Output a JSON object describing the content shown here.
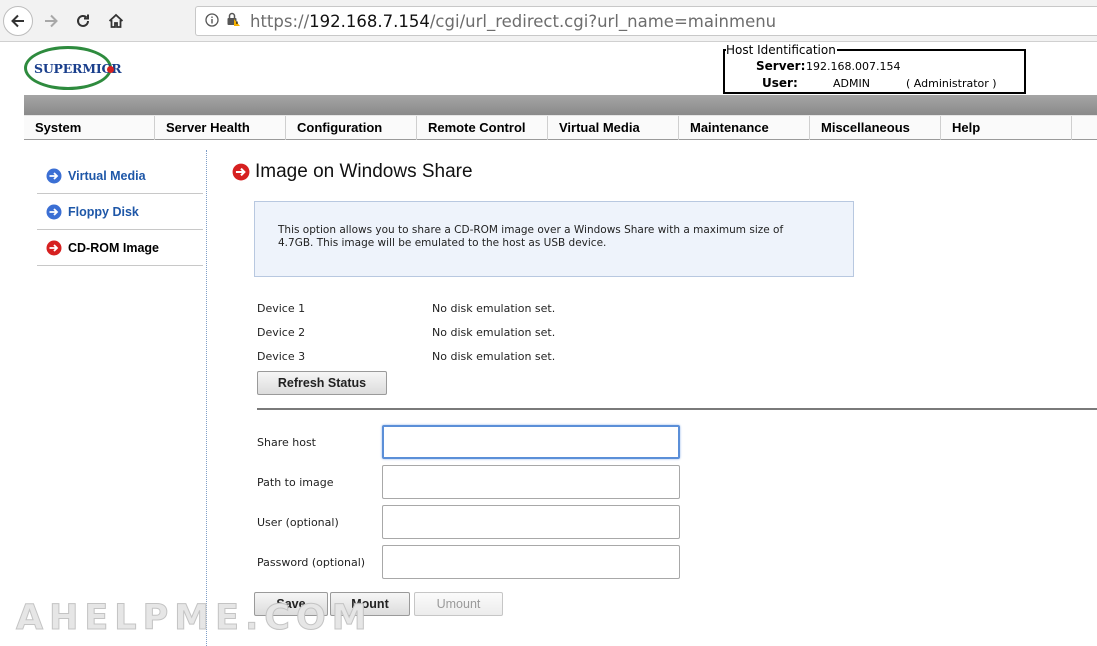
{
  "browser": {
    "url_prefix": "https://",
    "url_host": "192.168.7.154",
    "url_path": "/cgi/url_redirect.cgi?url_name=mainmenu",
    "icons": [
      "back-arrow-icon",
      "forward-arrow-icon",
      "reload-icon",
      "home-icon",
      "info-icon",
      "insecure-lock-icon"
    ]
  },
  "header": {
    "logo_text": "SUPERMICR",
    "host_identification": {
      "legend": "Host Identification",
      "server_label": "Server:",
      "server_value": "192.168.007.154",
      "user_label": "User:",
      "user_value": "ADMIN",
      "user_role": "( Administrator )"
    }
  },
  "menu": {
    "items": [
      "System",
      "Server Health",
      "Configuration",
      "Remote Control",
      "Virtual Media",
      "Maintenance",
      "Miscellaneous",
      "Help"
    ]
  },
  "sidebar": {
    "items": [
      {
        "label": "Virtual Media",
        "active": false,
        "icon": "blue-arrow-icon"
      },
      {
        "label": "Floppy Disk",
        "active": false,
        "icon": "blue-arrow-icon"
      },
      {
        "label": "CD-ROM Image",
        "active": true,
        "icon": "red-arrow-icon"
      }
    ]
  },
  "main": {
    "title": "Image on Windows Share",
    "info_line1": "This option allows you to share a CD-ROM image over a Windows Share with a maximum size of",
    "info_line2": "4.7GB. This image will be emulated to the host as USB device.",
    "devices": [
      {
        "label": "Device 1",
        "status": "No disk emulation set."
      },
      {
        "label": "Device 2",
        "status": "No disk emulation set."
      },
      {
        "label": "Device 3",
        "status": "No disk emulation set."
      }
    ],
    "refresh_button": "Refresh Status",
    "form": {
      "share_host_label": "Share host",
      "share_host_value": "",
      "path_label": "Path to image",
      "path_value": "",
      "user_label": "User (optional)",
      "user_value": "",
      "password_label": "Password (optional)",
      "password_value": ""
    },
    "buttons": {
      "save": "Save",
      "mount": "Mount",
      "umount": "Umount"
    }
  },
  "watermark": "AHELPME.COM",
  "colors": {
    "link_blue": "#1e57a8",
    "logo_green": "#2e8b3e",
    "accent_red": "#d62020",
    "info_bg": "#eef3fb"
  }
}
